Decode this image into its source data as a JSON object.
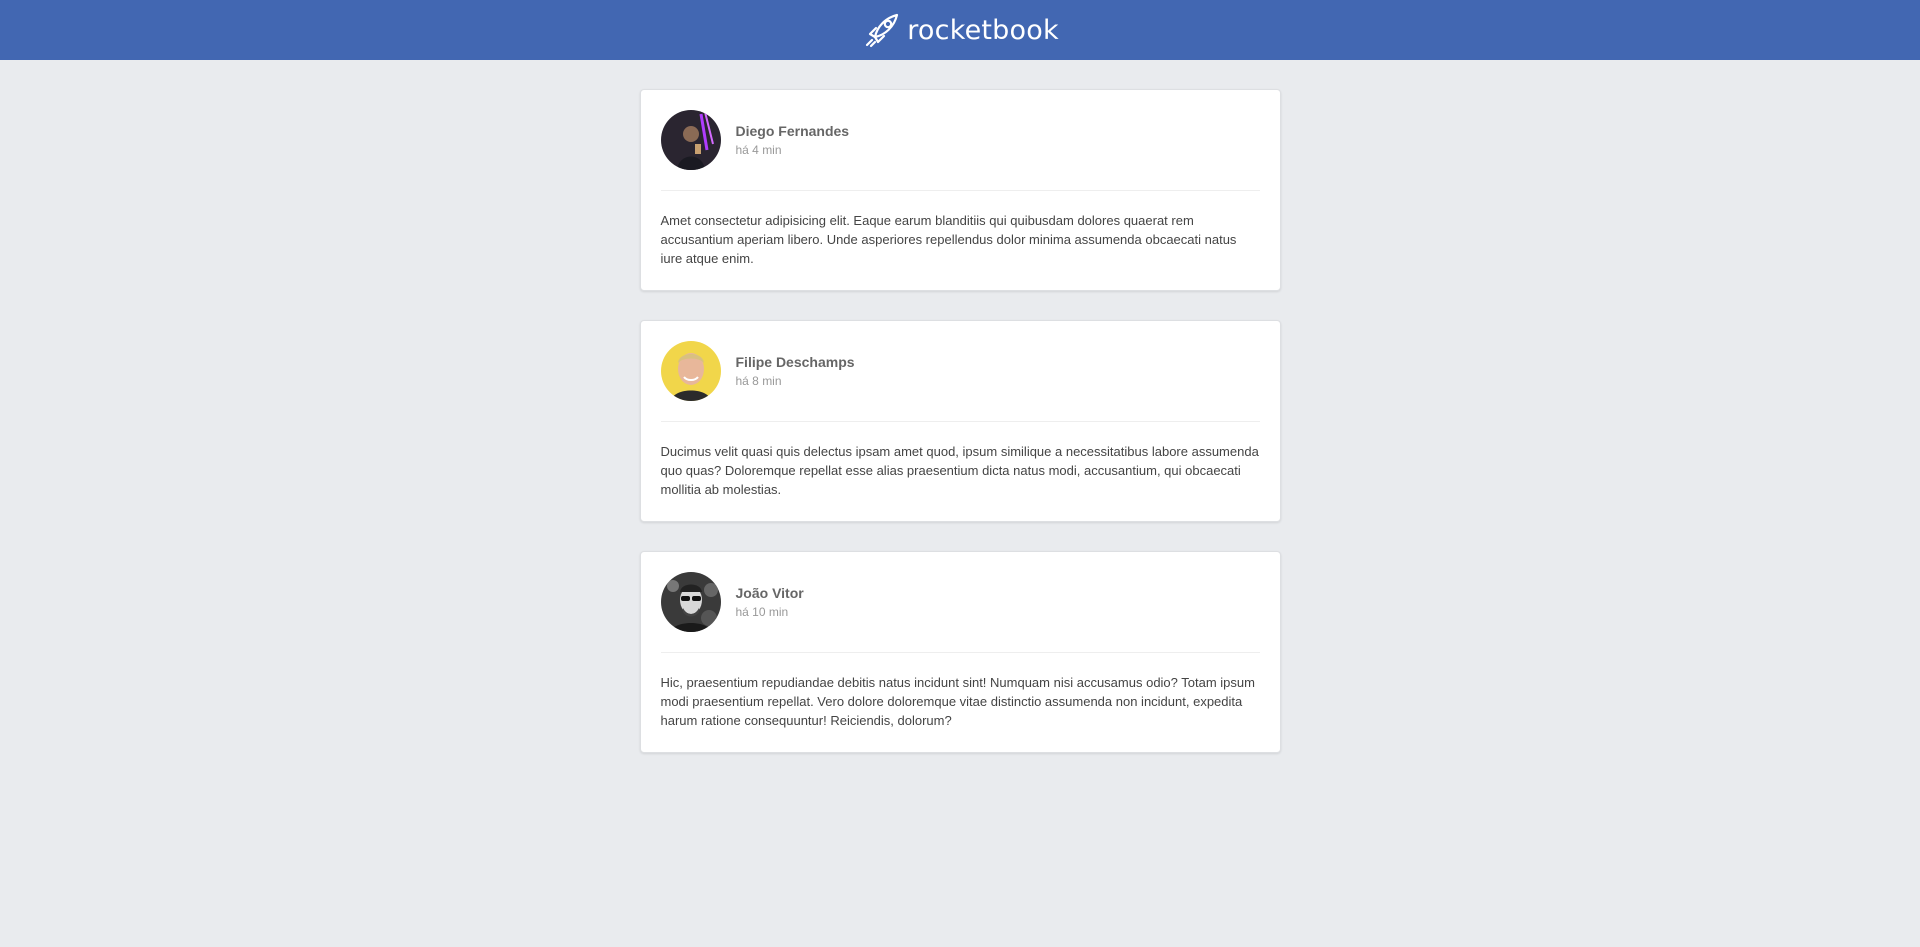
{
  "header": {
    "brand_name": "rocketbook",
    "logo_icon": "rocket-icon",
    "background": "#4267b2"
  },
  "posts": [
    {
      "author": "Diego Fernandes",
      "time": "há 4 min",
      "content": "Amet consectetur adipisicing elit. Eaque earum blanditiis qui quibusdam dolores quaerat rem accusantium aperiam libero. Unde asperiores repellendus dolor minima assumenda obcaecati natus iure atque enim."
    },
    {
      "author": "Filipe Deschamps",
      "time": "há 8 min",
      "content": "Ducimus velit quasi quis delectus ipsam amet quod, ipsum similique a necessitatibus labore assumenda quo quas? Doloremque repellat esse alias praesentium dicta natus modi, accusantium, qui obcaecati mollitia ab molestias."
    },
    {
      "author": "João Vitor",
      "time": "há 10 min",
      "content": "Hic, praesentium repudiandae debitis natus incidunt sint! Numquam nisi accusamus odio? Totam ipsum modi praesentium repellat. Vero dolore doloremque vitae distinctio assumenda non incidunt, expedita harum ratione consequuntur! Reiciendis, dolorum?"
    }
  ]
}
